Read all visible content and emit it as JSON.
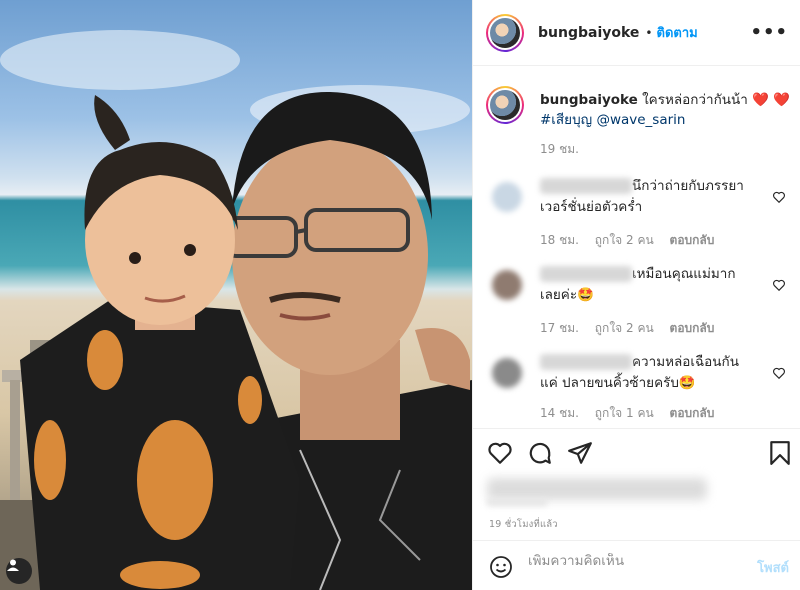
{
  "post": {
    "username": "bungbaiyoke",
    "dot": "•",
    "follow_label": "ติดตาม",
    "more_label": "•••",
    "caption": {
      "username": "bungbaiyoke",
      "text": "ใครหล่อกว่ากันน้า",
      "hearts": "❤️ ❤️",
      "hashtag": "#เสียบุญ",
      "mention": "@wave_sarin",
      "time": "19 ชม."
    },
    "comments": [
      {
        "text": "นึกว่าถ่ายกับภรรยา เวอร์ชั่นย่อตัวคร่ำ",
        "time": "18 ชม.",
        "likes": "ถูกใจ 2 คน",
        "reply": "ตอบกลับ",
        "avatar_color": "#c9d7e4"
      },
      {
        "text": "เหมือนคุณแม่มาก เลยค่ะ🤩",
        "time": "17 ชม.",
        "likes": "ถูกใจ 2 คน",
        "reply": "ตอบกลับ",
        "avatar_color": "#8f7b70"
      },
      {
        "text": "ความหล่อเฉือนกันแค่ ปลายขนคิ้วซ้ายครับ🤩",
        "time": "14 ชม.",
        "likes": "ถูกใจ 1 คน",
        "reply": "ตอบกลับ",
        "avatar_color": "#8a8a8a"
      }
    ],
    "post_time": "19 ชั่วโมงที่แล้ว",
    "comment_box": {
      "placeholder": "เพิ่มความคิดเห็น",
      "post_label": "โพสต์"
    },
    "icons": [
      "heart-icon",
      "comment-icon",
      "share-icon",
      "bookmark-icon",
      "emoji-icon",
      "user-tag-icon"
    ]
  }
}
